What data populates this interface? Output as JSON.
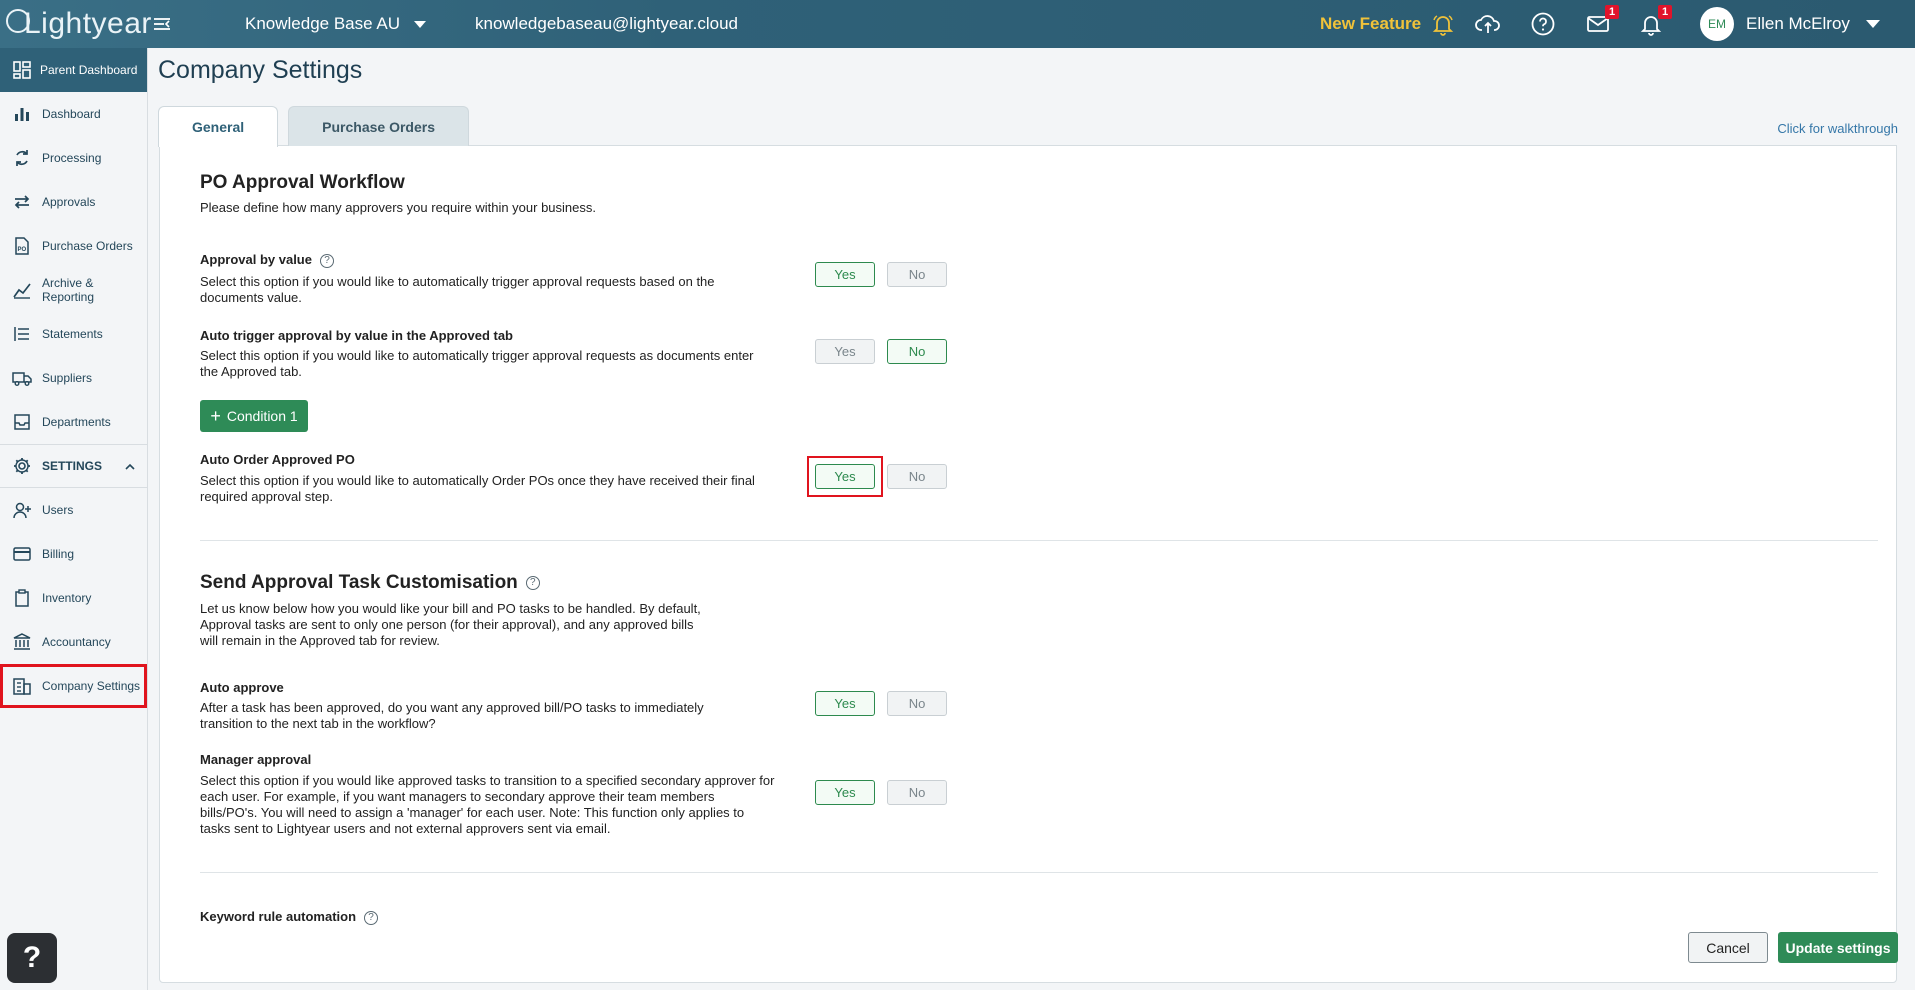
{
  "topbar": {
    "logo_text": "Lightyear",
    "workspace": "Knowledge Base AU",
    "email": "knowledgebaseau@lightyear.cloud",
    "new_feature": "New Feature",
    "mail_badge": "1",
    "bell_badge": "1",
    "avatar_initials": "EM",
    "user_name": "Ellen McElroy"
  },
  "sidebar": {
    "parent": "Parent Dashboard",
    "items": [
      {
        "label": "Dashboard",
        "icon": "bar-chart-icon"
      },
      {
        "label": "Processing",
        "icon": "refresh-icon"
      },
      {
        "label": "Approvals",
        "icon": "arrows-icon"
      },
      {
        "label": "Purchase Orders",
        "icon": "po-document-icon"
      },
      {
        "label": "Archive & Reporting",
        "icon": "line-chart-icon"
      },
      {
        "label": "Statements",
        "icon": "list-icon"
      },
      {
        "label": "Suppliers",
        "icon": "truck-icon"
      },
      {
        "label": "Departments",
        "icon": "inbox-icon"
      }
    ],
    "settings_label": "SETTINGS",
    "settings_items": [
      {
        "label": "Users",
        "icon": "add-user-icon"
      },
      {
        "label": "Billing",
        "icon": "card-icon"
      },
      {
        "label": "Inventory",
        "icon": "clipboard-icon"
      },
      {
        "label": "Accountancy",
        "icon": "bank-icon"
      },
      {
        "label": "Company Settings",
        "icon": "building-icon"
      }
    ]
  },
  "page": {
    "title": "Company Settings",
    "tabs": [
      "General",
      "Purchase Orders"
    ],
    "walkthrough": "Click for walkthrough"
  },
  "po_workflow": {
    "title": "PO Approval Workflow",
    "desc": "Please define how many approvers you require within your business.",
    "options": [
      {
        "label": "Approval by value",
        "desc": "Select this option if you would like to automatically trigger approval requests based on the documents value.",
        "value": "Yes"
      },
      {
        "label": "Auto trigger approval by value in the Approved tab",
        "desc": "Select this option if you would like to automatically trigger approval requests as documents enter the Approved tab.",
        "value": "No"
      },
      {
        "label": "Auto Order Approved PO",
        "desc": "Select this option if you would like to automatically Order POs once they have received their final required approval step.",
        "value": "Yes"
      }
    ],
    "condition_button": "Condition 1"
  },
  "task_custom": {
    "title": "Send Approval Task Customisation",
    "desc": "Let us know below how you would like your bill and PO tasks to be handled. By default, Approval tasks are sent to only one person (for their approval), and any approved bills will remain in the Approved tab for review.",
    "options": [
      {
        "label": "Auto approve",
        "desc": "After a task has been approved, do you want any approved bill/PO tasks to immediately transition to the next tab in the workflow?",
        "value": "Yes"
      },
      {
        "label": "Manager approval",
        "desc": "Select this option if you would like approved tasks to transition to a specified secondary approver for each user. For example, if you want managers to secondary approve their team members bills/PO's. You will need to assign a 'manager' for each user. Note: This function only applies to tasks sent to Lightyear users and not external approvers sent via email.",
        "value": "Yes"
      }
    ]
  },
  "keyword": {
    "label": "Keyword rule automation"
  },
  "yes_label": "Yes",
  "no_label": "No",
  "footer": {
    "cancel": "Cancel",
    "update": "Update settings"
  },
  "colors": {
    "brand": "#2f6178",
    "accent_green": "#2e8b57",
    "new_feature": "#f0c23a",
    "highlight": "#e0141e"
  }
}
